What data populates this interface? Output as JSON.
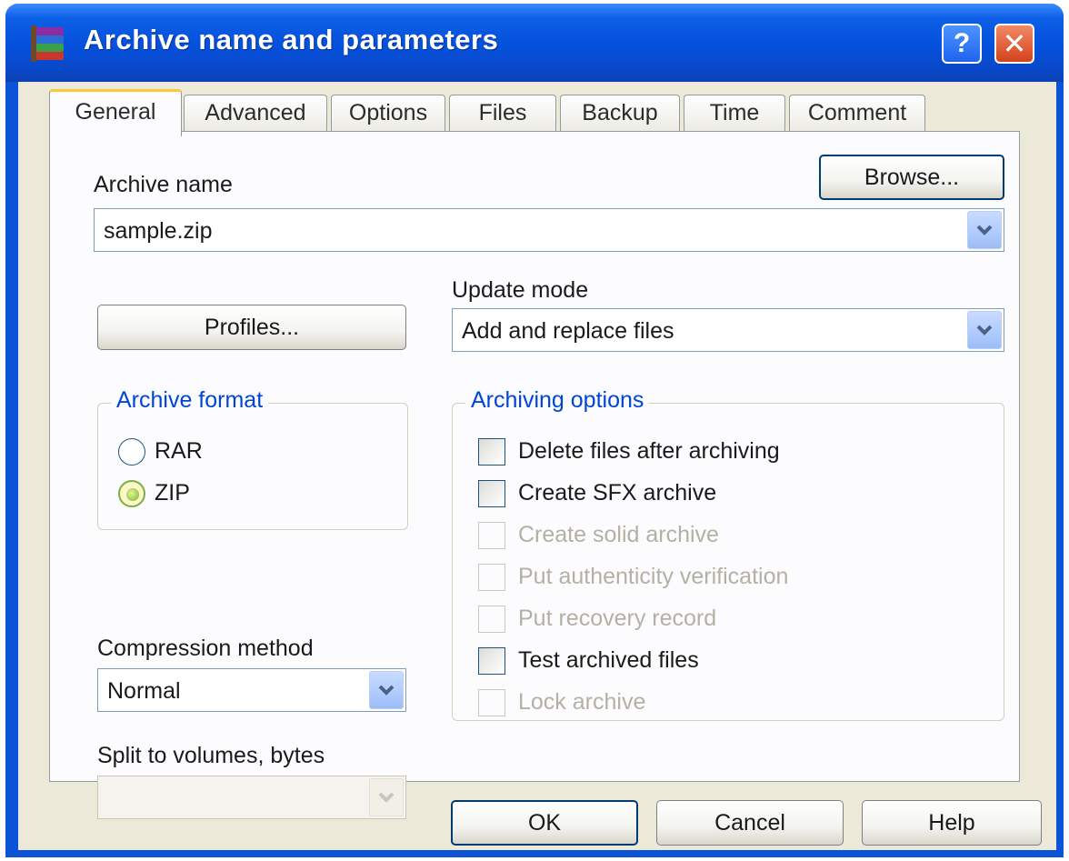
{
  "window": {
    "title": "Archive name and parameters",
    "help_button": "?",
    "close_button": "✕"
  },
  "tabs": [
    "General",
    "Advanced",
    "Options",
    "Files",
    "Backup",
    "Time",
    "Comment"
  ],
  "active_tab": "General",
  "general": {
    "archive_name_label": "Archive name",
    "archive_name_value": "sample.zip",
    "browse_button": "Browse...",
    "update_mode_label": "Update mode",
    "update_mode_value": "Add and replace files",
    "profiles_button": "Profiles...",
    "archive_format": {
      "title": "Archive format",
      "options": [
        "RAR",
        "ZIP"
      ],
      "selected": "ZIP"
    },
    "compression_label": "Compression method",
    "compression_value": "Normal",
    "split_label": "Split to volumes, bytes",
    "split_value": "",
    "archiving_options": {
      "title": "Archiving options",
      "items": [
        {
          "label": "Delete files after archiving",
          "checked": false,
          "enabled": true
        },
        {
          "label": "Create SFX archive",
          "checked": false,
          "enabled": true
        },
        {
          "label": "Create solid archive",
          "checked": false,
          "enabled": false
        },
        {
          "label": "Put authenticity verification",
          "checked": false,
          "enabled": false
        },
        {
          "label": "Put recovery record",
          "checked": false,
          "enabled": false
        },
        {
          "label": "Test archived files",
          "checked": false,
          "enabled": true
        },
        {
          "label": "Lock archive",
          "checked": false,
          "enabled": false
        }
      ]
    }
  },
  "footer": {
    "ok": "OK",
    "cancel": "Cancel",
    "help": "Help"
  },
  "annotation": {
    "arrow_color": "#e8140f",
    "points_to": "ZIP"
  },
  "colors": {
    "titlebar": "#0550dc",
    "dialog_bg": "#ece9d8",
    "group_title": "#0046d5",
    "active_tab_accent": "#ffc83c"
  }
}
